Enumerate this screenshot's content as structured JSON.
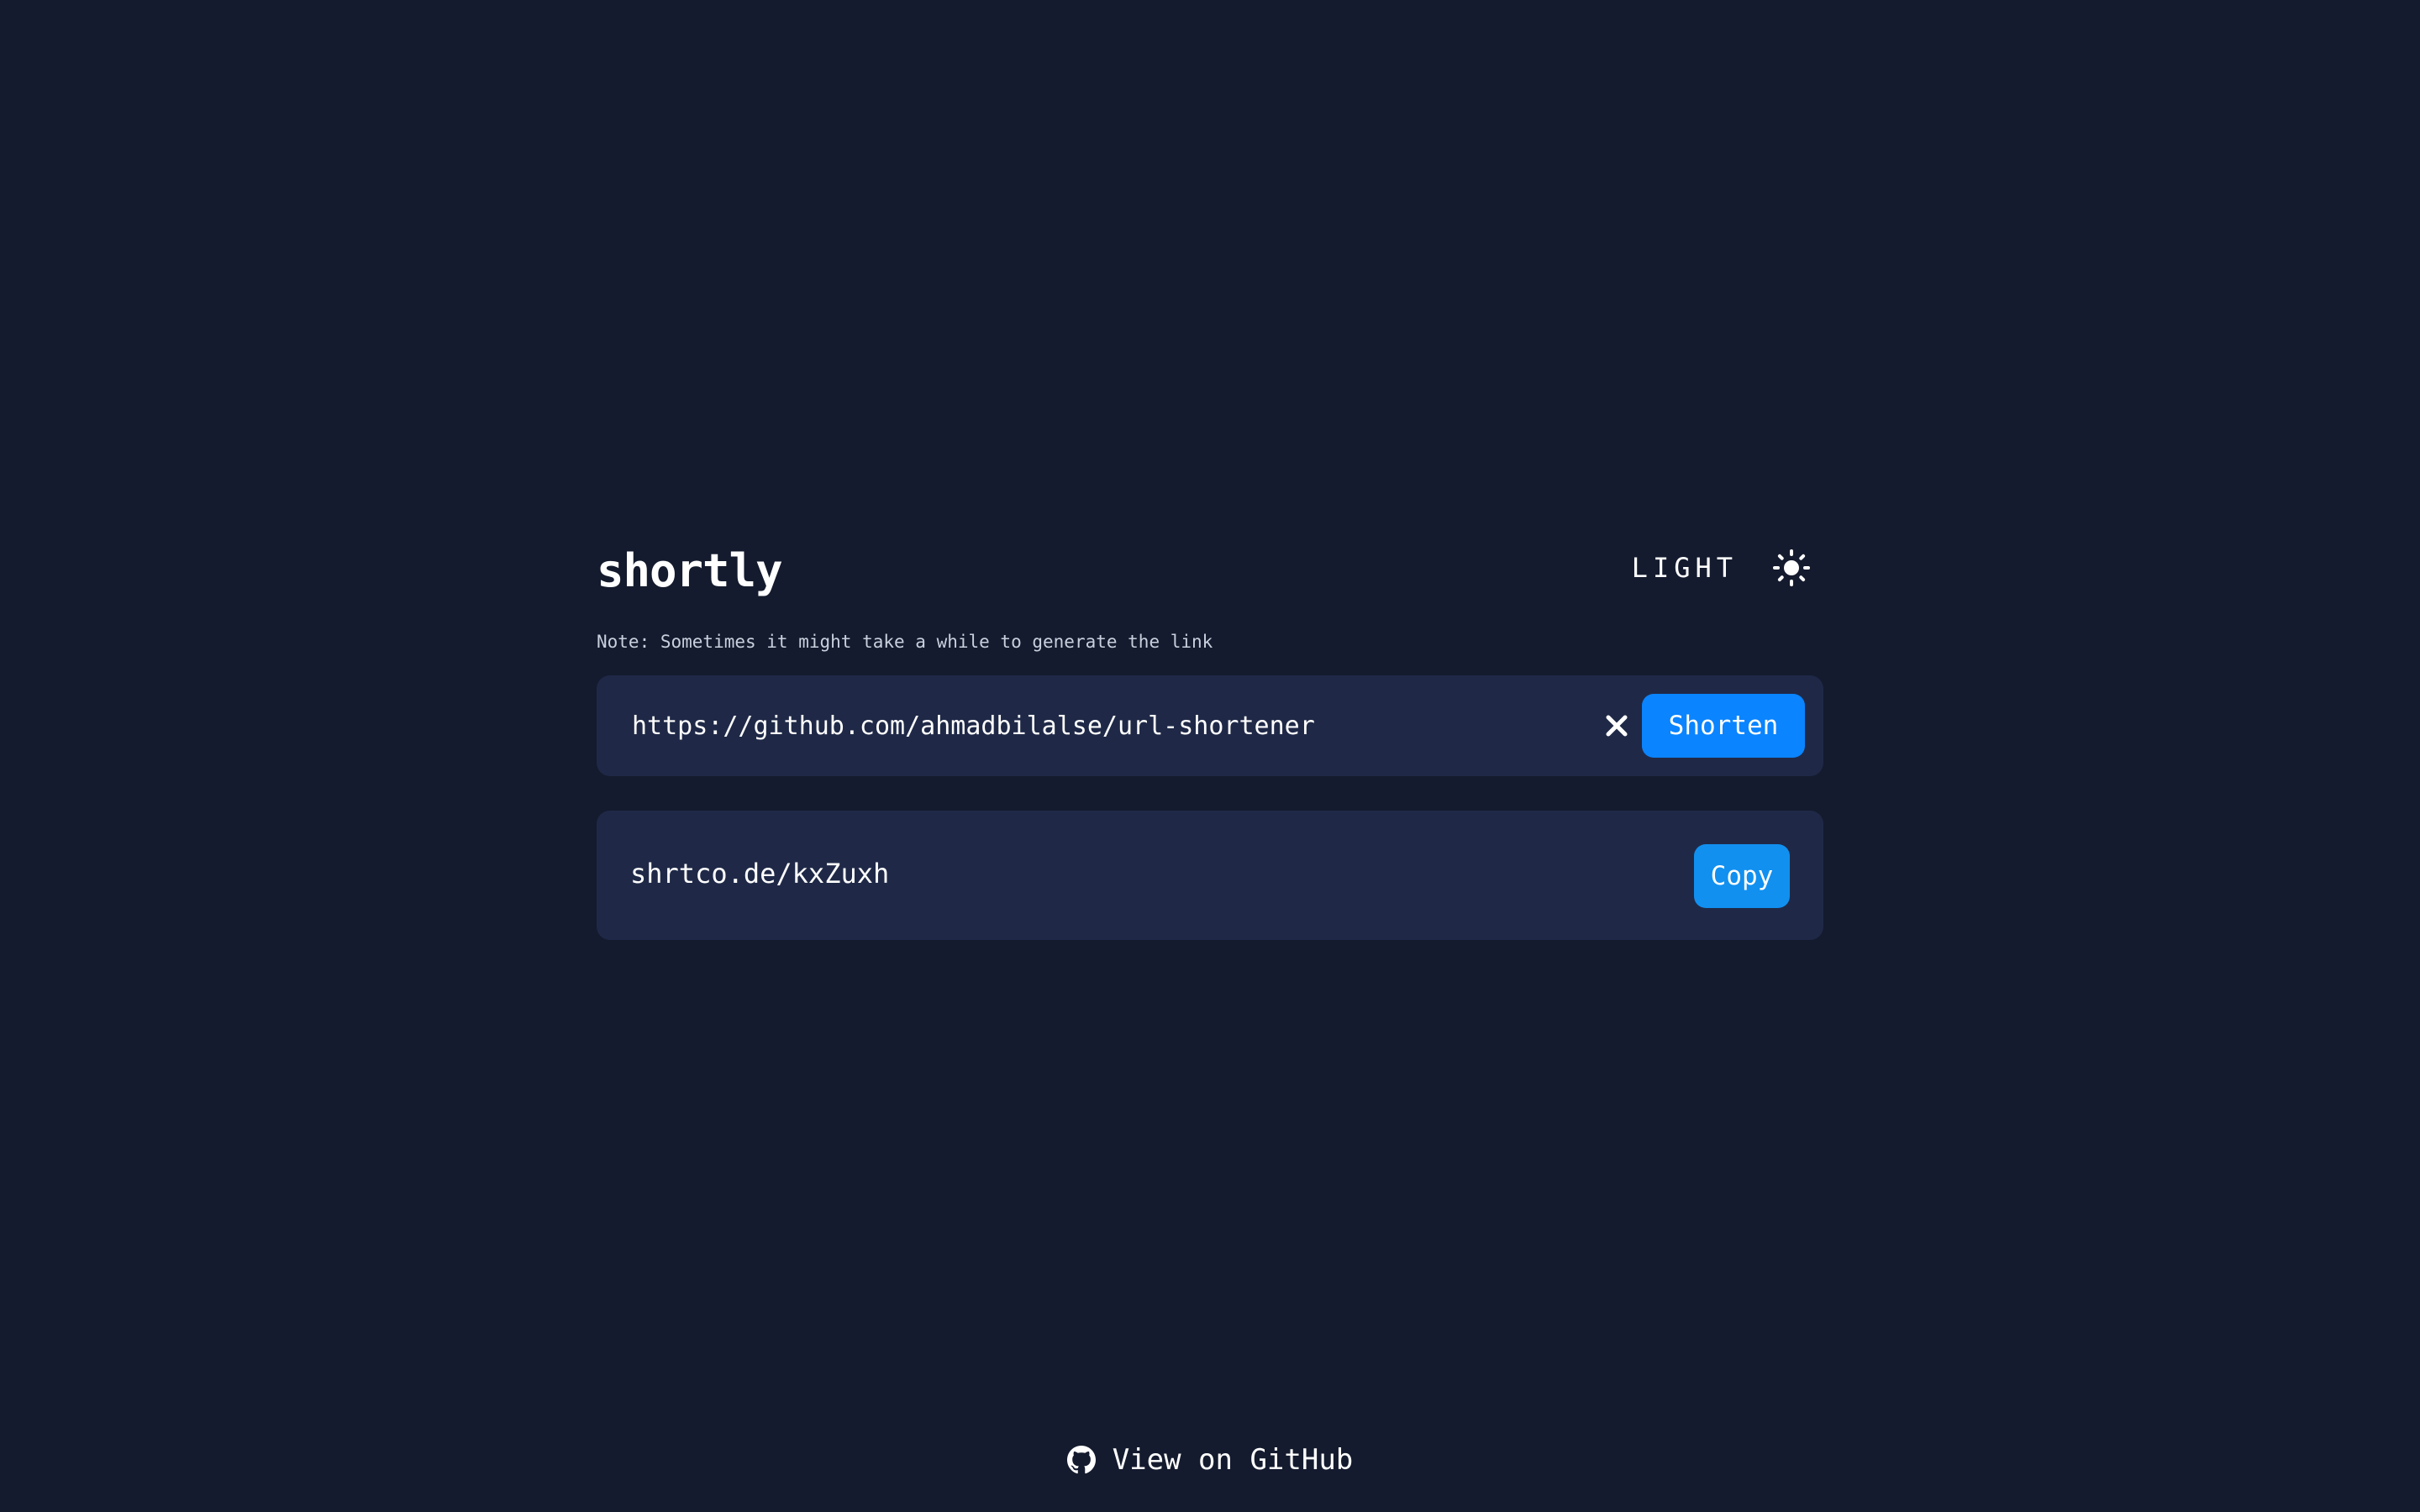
{
  "app": {
    "logo": "shortly"
  },
  "theme_toggle": {
    "label": "LIGHT",
    "icon": "sun-icon"
  },
  "note": "Note: Sometimes it might take a while to generate the link",
  "shortener": {
    "input_value": "https://github.com/ahmadbilalse/url-shortener",
    "clear_icon": "close-icon",
    "button_label": "Shorten"
  },
  "result": {
    "short_url": "shrtco.de/kxZuxh",
    "copy_label": "Copy"
  },
  "footer": {
    "icon": "github-icon",
    "link_text": "View on GitHub"
  },
  "colors": {
    "background": "#141b2e",
    "card": "#1f2947",
    "primary": "#0a84ff",
    "copy_button": "#1190f0",
    "text": "#ffffff"
  }
}
